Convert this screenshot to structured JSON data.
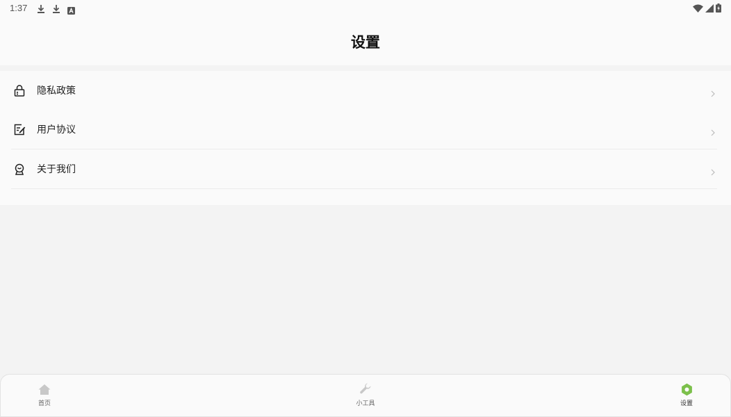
{
  "status_bar": {
    "time": "1:37",
    "left_icons": [
      "download-icon",
      "download-icon",
      "app-notification-icon"
    ],
    "right_icons": [
      "wifi-icon",
      "cellular-signal-icon",
      "battery-charging-icon"
    ]
  },
  "header": {
    "title": "设置"
  },
  "menu": {
    "items": [
      {
        "label": "隐私政策",
        "icon": "lock-icon"
      },
      {
        "label": "用户协议",
        "icon": "document-edit-icon"
      },
      {
        "label": "关于我们",
        "icon": "info-person-icon"
      }
    ]
  },
  "tabbar": {
    "tabs": [
      {
        "label": "首页",
        "icon": "home-icon",
        "active": false
      },
      {
        "label": "小工具",
        "icon": "wrench-icon",
        "active": false
      },
      {
        "label": "设置",
        "icon": "gear-icon",
        "active": true
      }
    ],
    "active_color": "#7cc04b",
    "inactive_icon_color": "#c8c8c8"
  },
  "colors": {
    "background": "#f3f3f3",
    "surface": "#fafafa",
    "divider": "#ececec",
    "chevron": "#bbbbbb"
  }
}
